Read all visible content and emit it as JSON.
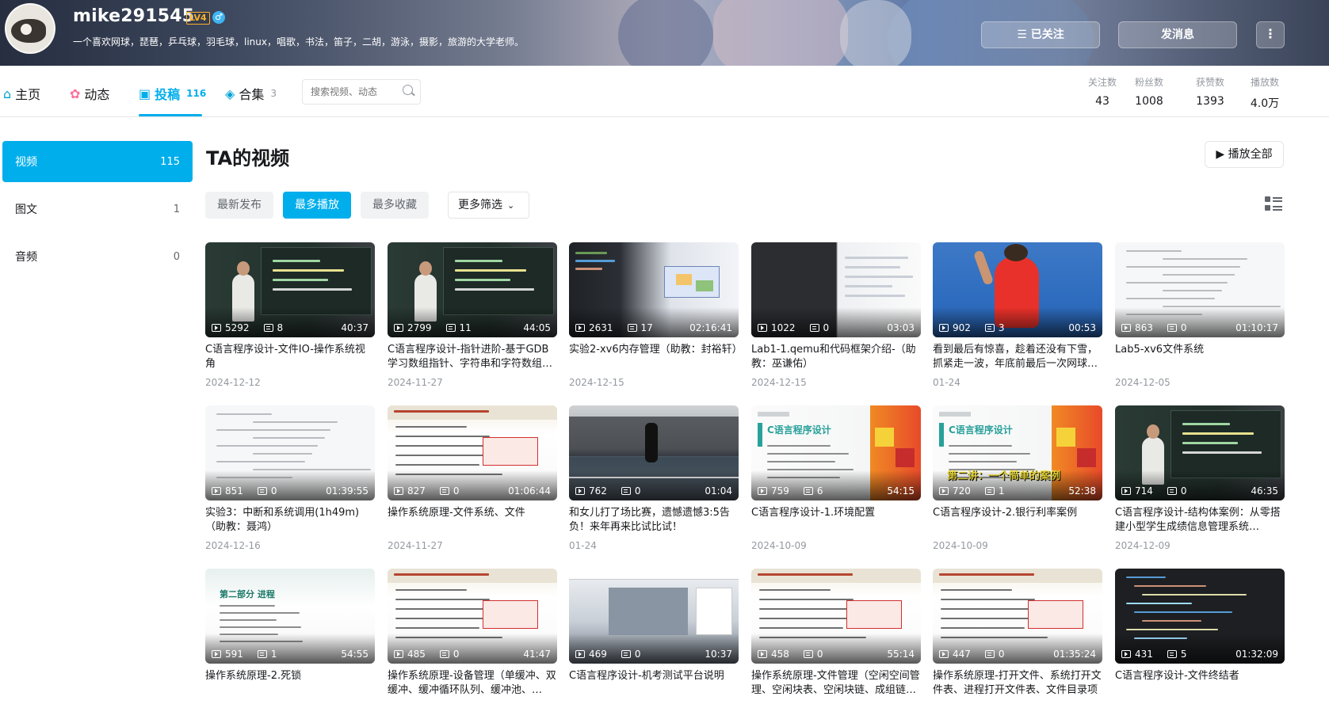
{
  "header": {
    "username": "mike291545",
    "level": "LV4",
    "gender_symbol": "♂",
    "sign": "一个喜欢网球，琵琶，乒乓球，羽毛球，linux，唱歌，书法，笛子，二胡，游泳，摄影，旅游的大学老师。",
    "follow_label": "已关注",
    "message_label": "发消息",
    "more_label": "⋮"
  },
  "nav": {
    "tabs": [
      {
        "label": "主页",
        "count": ""
      },
      {
        "label": "动态",
        "count": ""
      },
      {
        "label": "投稿",
        "count": "116"
      },
      {
        "label": "合集",
        "count": "3"
      }
    ],
    "search_placeholder": "搜索视频、动态",
    "stats": [
      {
        "label": "关注数",
        "value": "43"
      },
      {
        "label": "粉丝数",
        "value": "1008"
      },
      {
        "label": "获赞数",
        "value": "1393"
      },
      {
        "label": "播放数",
        "value": "4.0万"
      }
    ]
  },
  "sidebar": {
    "items": [
      {
        "label": "视频",
        "count": "115"
      },
      {
        "label": "图文",
        "count": "1"
      },
      {
        "label": "音频",
        "count": "0"
      }
    ]
  },
  "main": {
    "title": "TA的视频",
    "play_all": "播放全部",
    "filters": [
      "最新发布",
      "最多播放",
      "最多收藏"
    ],
    "more_filter": "更多筛选",
    "videos": [
      {
        "plays": "5292",
        "danmaku": "8",
        "duration": "40:37",
        "title": "C语言程序设计-文件IO-操作系统视角",
        "date": "2024-12-12"
      },
      {
        "plays": "2799",
        "danmaku": "11",
        "duration": "44:05",
        "title": "C语言程序设计-指针进阶-基于GDB学习数组指针、字符串和字符数组的区别",
        "date": "2024-11-27"
      },
      {
        "plays": "2631",
        "danmaku": "17",
        "duration": "02:16:41",
        "title": "实验2-xv6内存管理（助教：封裕轩）",
        "date": "2024-12-15"
      },
      {
        "plays": "1022",
        "danmaku": "0",
        "duration": "03:03",
        "title": "Lab1-1.qemu和代码框架介绍-（助教：巫谦佑）",
        "date": "2024-12-15"
      },
      {
        "plays": "902",
        "danmaku": "3",
        "duration": "00:53",
        "title": "看到最后有惊喜，趁着还没有下雪，抓紧走一波，年底前最后一次网球约球",
        "date": "01-24"
      },
      {
        "plays": "863",
        "danmaku": "0",
        "duration": "01:10:17",
        "title": "Lab5-xv6文件系统",
        "date": "2024-12-05"
      },
      {
        "plays": "851",
        "danmaku": "0",
        "duration": "01:39:55",
        "title": "实验3：中断和系统调用(1h49m)（助教：聂鸿）",
        "date": "2024-12-16"
      },
      {
        "plays": "827",
        "danmaku": "0",
        "duration": "01:06:44",
        "title": "操作系统原理-文件系统、文件",
        "date": "2024-11-27"
      },
      {
        "plays": "762",
        "danmaku": "0",
        "duration": "01:04",
        "title": "和女儿打了场比赛，遗憾遗憾3:5告负！来年再来比试比试！",
        "date": "01-24"
      },
      {
        "plays": "759",
        "danmaku": "6",
        "duration": "54:15",
        "title": "C语言程序设计-1.环境配置",
        "date": "2024-10-09"
      },
      {
        "plays": "720",
        "danmaku": "1",
        "duration": "52:38",
        "title": "C语言程序设计-2.银行利率案例",
        "date": "2024-10-09"
      },
      {
        "plays": "714",
        "danmaku": "0",
        "duration": "46:35",
        "title": "C语言程序设计-结构体案例：从零搭建小型学生成绩信息管理系统（Linux）",
        "date": "2024-12-09"
      },
      {
        "plays": "591",
        "danmaku": "1",
        "duration": "54:55",
        "title": "操作系统原理-2.死锁",
        "date": ""
      },
      {
        "plays": "485",
        "danmaku": "0",
        "duration": "41:47",
        "title": "操作系统原理-设备管理（单缓冲、双缓冲、缓冲循环队列、缓冲池、spooling）",
        "date": ""
      },
      {
        "plays": "469",
        "danmaku": "0",
        "duration": "10:37",
        "title": "C语言程序设计-机考测试平台说明",
        "date": ""
      },
      {
        "plays": "458",
        "danmaku": "0",
        "duration": "55:14",
        "title": "操作系统原理-文件管理（空闲空间管理、空闲块表、空闲块链、成组链接法）",
        "date": ""
      },
      {
        "plays": "447",
        "danmaku": "0",
        "duration": "01:35:24",
        "title": "操作系统原理-打开文件、系统打开文件表、进程打开文件表、文件目录项",
        "date": ""
      },
      {
        "plays": "431",
        "danmaku": "5",
        "duration": "01:32:09",
        "title": "C语言程序设计-文件终结者",
        "date": ""
      }
    ],
    "thumb_overlays": {
      "v10_brand": "C语言程序设计",
      "v11_brand": "C语言程序设计",
      "v11_caption": "第二讲：一个简单的案例",
      "v13_course": "第二部分 进程"
    }
  },
  "colors": {
    "accent": "#00aeec",
    "text": "#18191c",
    "muted": "#9499a0"
  }
}
